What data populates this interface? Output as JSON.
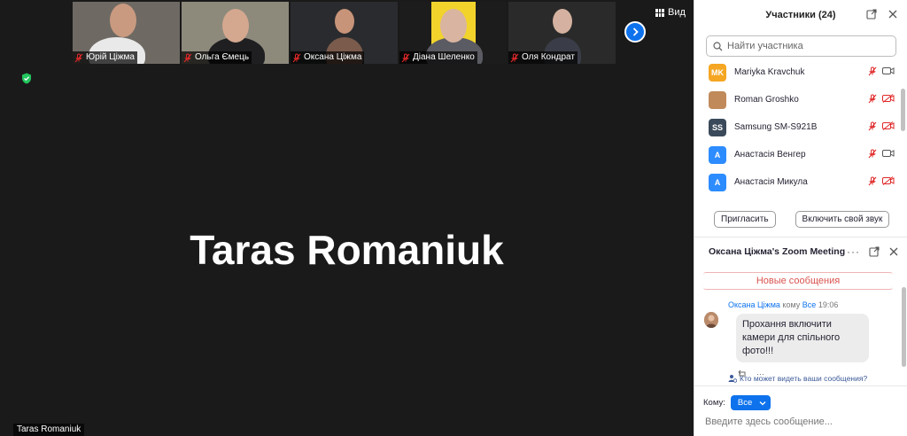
{
  "video": {
    "thumbnails": [
      {
        "name": "Юрій Ціжма",
        "bg": "#6e6a63",
        "shirt": "#e9e9e9",
        "skin": "#c99a80"
      },
      {
        "name": "Ольга Ємець",
        "bg": "#8d8a7c",
        "shirt": "#1f1f22",
        "skin": "#d4a88f"
      },
      {
        "name": "Оксана Ціжма",
        "bg": "#2a2b2e",
        "shirt": "#7a5b4c",
        "skin": "#c89479"
      },
      {
        "name": "Діана Шеленко",
        "bg": "#1c1c1c",
        "shirt": "#5b5b63",
        "skin": "#d9b4a0"
      },
      {
        "name": "Оля Кондрат",
        "bg": "#2a2a2a",
        "shirt": "#3a3d47",
        "skin": "#d4b1a0"
      }
    ],
    "view_label": "Вид",
    "active_speaker": "Taras Romaniuk",
    "name_tag": "Taras Romaniuk"
  },
  "participants": {
    "title": "Участники (24)",
    "search_placeholder": "Найти участника",
    "list": [
      {
        "initials": "MK",
        "color": "#f5a623",
        "name": "Mariyka Kravchuk",
        "video_off": false
      },
      {
        "initials": "",
        "color": "#c08a5a",
        "name": "Roman Groshko",
        "video_off": true
      },
      {
        "initials": "SS",
        "color": "#3b4a5a",
        "name": "Samsung SM-S921B",
        "video_off": true
      },
      {
        "initials": "A",
        "color": "#2d8cff",
        "name": "Анастасія Венгер",
        "video_off": false
      },
      {
        "initials": "A",
        "color": "#2d8cff",
        "name": "Анастасія Микула",
        "video_off": true
      }
    ],
    "invite_label": "Пригласить",
    "unmute_label": "Включить свой звук"
  },
  "chat": {
    "title": "Оксана Ціжма's Zoom Meeting",
    "new_messages": "Новые сообщения",
    "message": {
      "from": "Оксана Ціжма",
      "to_word": "кому",
      "to": "Все",
      "time": "19:06",
      "text": "Прохання включити камери для спільного фото!!!"
    },
    "who_sees": "Кто может видеть ваши сообщения?",
    "to_label": "Кому:",
    "to_value": "Все",
    "input_placeholder": "Введите здесь сообщение..."
  },
  "colors": {
    "accent": "#0e72ed",
    "muted_red": "#e02828",
    "new_messages_red": "#d9534f"
  }
}
